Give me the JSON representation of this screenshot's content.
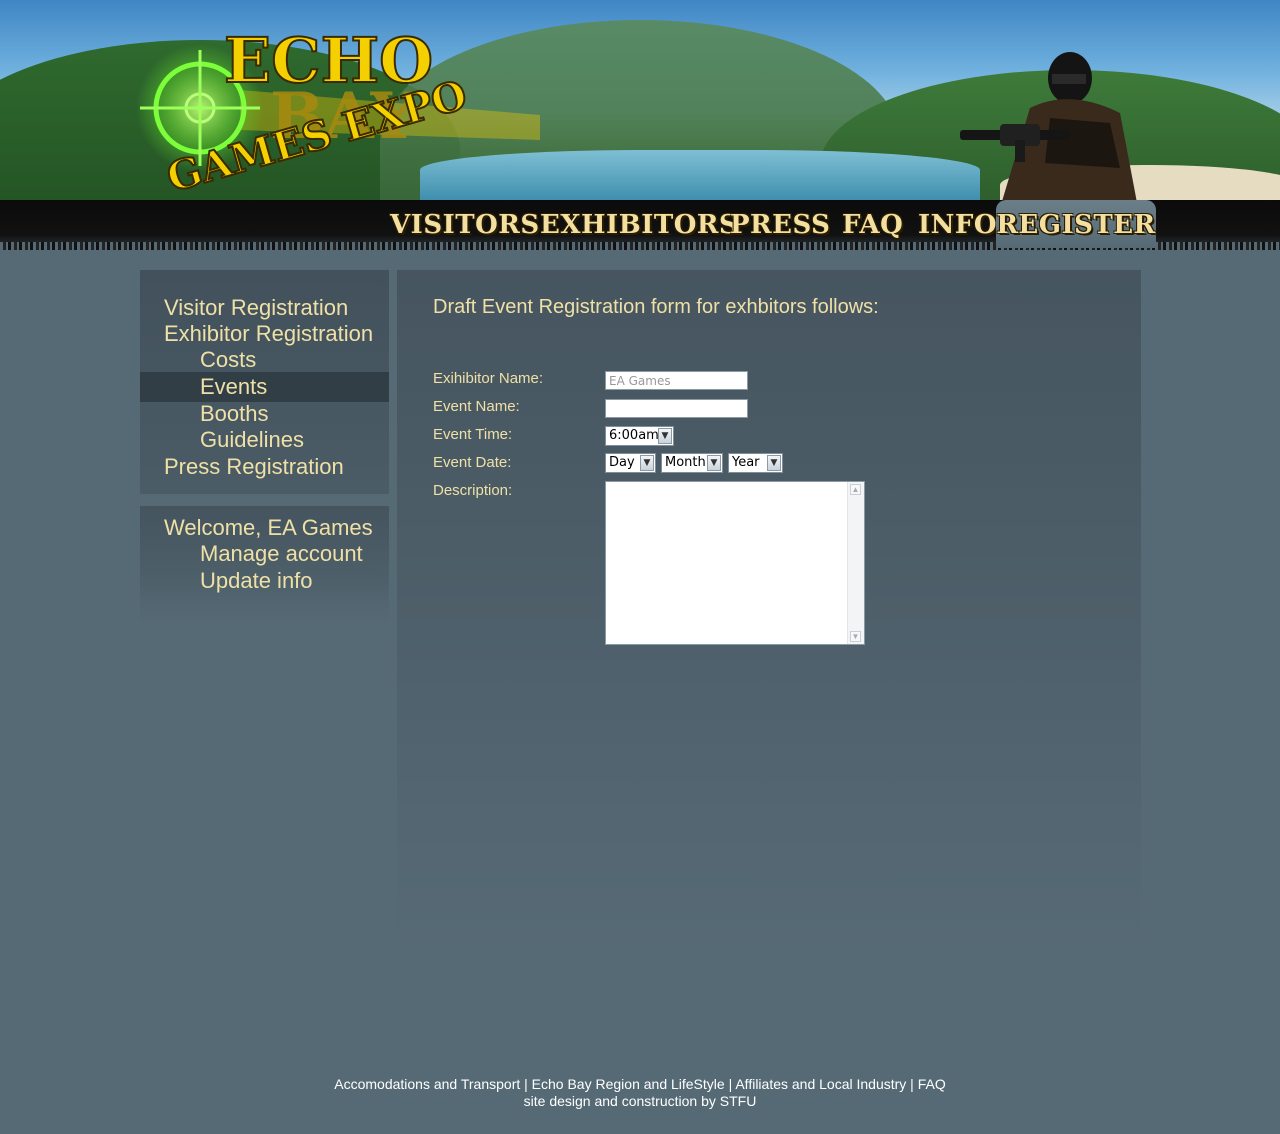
{
  "header": {
    "logo": {
      "line1": "ECHO",
      "line2": "BAY",
      "line3": "GAMES EXPO"
    },
    "nav": [
      {
        "label": "VISITORS"
      },
      {
        "label": "EXHIBITORS"
      },
      {
        "label": "PRESS"
      },
      {
        "label": "FAQ"
      },
      {
        "label": "INFO"
      },
      {
        "label": "REGISTER"
      }
    ],
    "active_nav": "REGISTER"
  },
  "sidebar": {
    "registration_menu": [
      {
        "label": "Visitor Registration",
        "level": 1
      },
      {
        "label": "Exhibitor Registration",
        "level": 1
      },
      {
        "label": "Costs",
        "level": 2
      },
      {
        "label": "Events",
        "level": 2,
        "active": true
      },
      {
        "label": "Booths",
        "level": 2
      },
      {
        "label": "Guidelines",
        "level": 2
      },
      {
        "label": "Press Registration",
        "level": 1
      }
    ],
    "account_menu": [
      {
        "label": "Welcome, EA Games",
        "level": 1
      },
      {
        "label": "Manage account",
        "level": 2
      },
      {
        "label": "Update info",
        "level": 2
      }
    ]
  },
  "form": {
    "title": "Draft Event Registration form for exhbitors follows:",
    "exhibitor_name": {
      "label": "Exihibitor Name:",
      "value": "EA Games"
    },
    "event_name": {
      "label": "Event Name:",
      "value": ""
    },
    "event_time": {
      "label": "Event Time:",
      "value": "6:00am"
    },
    "event_date": {
      "label": "Event Date:",
      "day": "Day",
      "month": "Month",
      "year": "Year"
    },
    "description": {
      "label": "Description:",
      "value": ""
    }
  },
  "footer": {
    "links": [
      "Accomodations and Transport",
      "Echo Bay Region and LifeStyle",
      "Affiliates and Local Industry",
      "FAQ"
    ],
    "separator": " | ",
    "credit": "site design and construction by STFU"
  },
  "colors": {
    "background": "#566a76",
    "menu_text": "#eee0a6",
    "active_menu_bg": "#323e46",
    "nav_text": "#f3dfa0",
    "logo_yellow": "#f5d000",
    "crosshair_green": "#7cff3a"
  }
}
